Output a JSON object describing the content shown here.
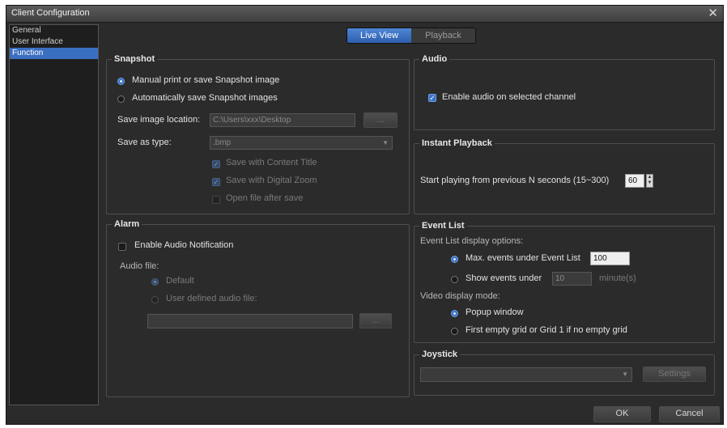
{
  "window": {
    "title": "Client Configuration",
    "close_glyph": "✕"
  },
  "sidebar": {
    "items": [
      {
        "label": "General"
      },
      {
        "label": "User Interface"
      },
      {
        "label": "Function"
      }
    ]
  },
  "tabs": [
    {
      "label": "Live View"
    },
    {
      "label": "Playback"
    }
  ],
  "snapshot": {
    "title": "Snapshot",
    "manual_label": "Manual print or save Snapshot image",
    "auto_label": "Automatically save Snapshot images",
    "location_label": "Save image location:",
    "location_value": "C:\\Users\\xxx\\Desktop",
    "browse_label": "...",
    "type_label": "Save as type:",
    "type_value": ".bmp",
    "content_title_label": "Save with Content Title",
    "digital_zoom_label": "Save with Digital Zoom",
    "open_after_label": "Open file after save"
  },
  "audio": {
    "title": "Audio",
    "enable_label": "Enable audio on selected channel"
  },
  "instant": {
    "title": "Instant Playback",
    "label": "Start playing from previous N seconds (15~300)",
    "value": "60"
  },
  "alarm": {
    "title": "Alarm",
    "enable_label": "Enable Audio Notification",
    "audio_file_label": "Audio file:",
    "default_label": "Default",
    "user_defined_label": "User defined audio file:",
    "browse_label": "..."
  },
  "event_list": {
    "title": "Event List",
    "display_options_label": "Event List display options:",
    "max_events_label": "Max. events under Event List",
    "max_events_value": "100",
    "show_under_label": "Show events under",
    "show_under_value": "10",
    "minutes_label": "minute(s)",
    "video_mode_label": "Video display mode:",
    "popup_label": "Popup window",
    "first_grid_label": "First empty grid or Grid 1 if no empty grid"
  },
  "joystick": {
    "title": "Joystick",
    "select_value": "",
    "settings_label": "Settings"
  },
  "footer": {
    "ok_label": "OK",
    "cancel_label": "Cancel"
  },
  "colors": {
    "accent": "#3b73c7",
    "background": "#2b2b2b"
  }
}
